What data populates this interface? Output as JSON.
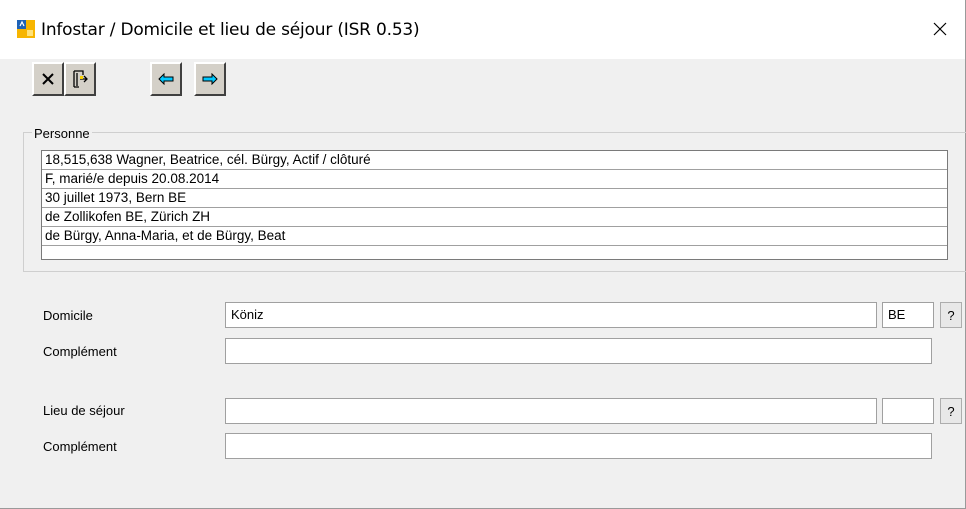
{
  "window": {
    "title": "Infostar / Domicile et lieu de séjour (ISR 0.53)",
    "close_glyph": "✕"
  },
  "toolbar": {
    "buttons": [
      {
        "name": "delete",
        "icon": "x-mark-icon"
      },
      {
        "name": "exit-door",
        "icon": "exit-door-icon"
      },
      {
        "name": "previous",
        "icon": "arrow-left-icon"
      },
      {
        "name": "next",
        "icon": "arrow-right-icon"
      }
    ]
  },
  "personne": {
    "label": "Personne",
    "lines": [
      "18,515,638  Wagner, Beatrice, cél. Bürgy, Actif / clôturé",
      "F, marié/e depuis 20.08.2014",
      "30 juillet 1973, Bern BE",
      "de Zollikofen BE, Zürich ZH",
      "de Bürgy, Anna-Maria, et de Bürgy, Beat"
    ]
  },
  "domicile": {
    "label": "Domicile",
    "value": "Köniz",
    "canton": "BE",
    "help": "?",
    "complement_label": "Complément",
    "complement_value": ""
  },
  "sejour": {
    "label": "Lieu de séjour",
    "value": "",
    "canton": "",
    "help": "?",
    "complement_label": "Complément",
    "complement_value": ""
  },
  "colors": {
    "arrow": "#00c8ff",
    "button_face": "#d4d0c8"
  }
}
